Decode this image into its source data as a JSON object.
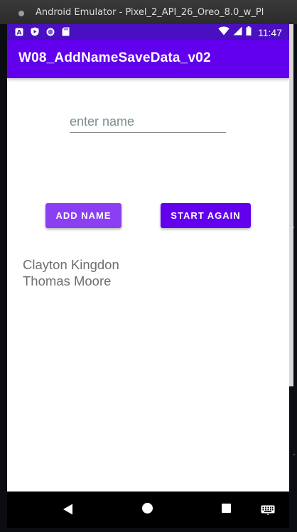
{
  "window": {
    "title": "Android Emulator - Pixel_2_API_26_Oreo_8.0_w_Pl"
  },
  "status_bar": {
    "time": "11:47",
    "left_icons": [
      "a-badge-icon",
      "play-protect-icon",
      "circle-icon",
      "sd-card-icon"
    ],
    "right_icons": [
      "wifi-icon",
      "signal-icon",
      "battery-icon"
    ],
    "colors": {
      "background": "#4a0fc1"
    }
  },
  "app_bar": {
    "title": "W08_AddNameSaveData_v02",
    "colors": {
      "background": "#6200ee"
    }
  },
  "form": {
    "name_input": {
      "placeholder": "enter name",
      "value": ""
    },
    "add_button_label": "ADD NAME",
    "start_again_button_label": "START AGAIN"
  },
  "names": [
    "Clayton Kingdon",
    "Thomas Moore"
  ],
  "nav_bar": {
    "icons": [
      "back-icon",
      "home-icon",
      "recents-icon",
      "keyboard-icon"
    ]
  }
}
